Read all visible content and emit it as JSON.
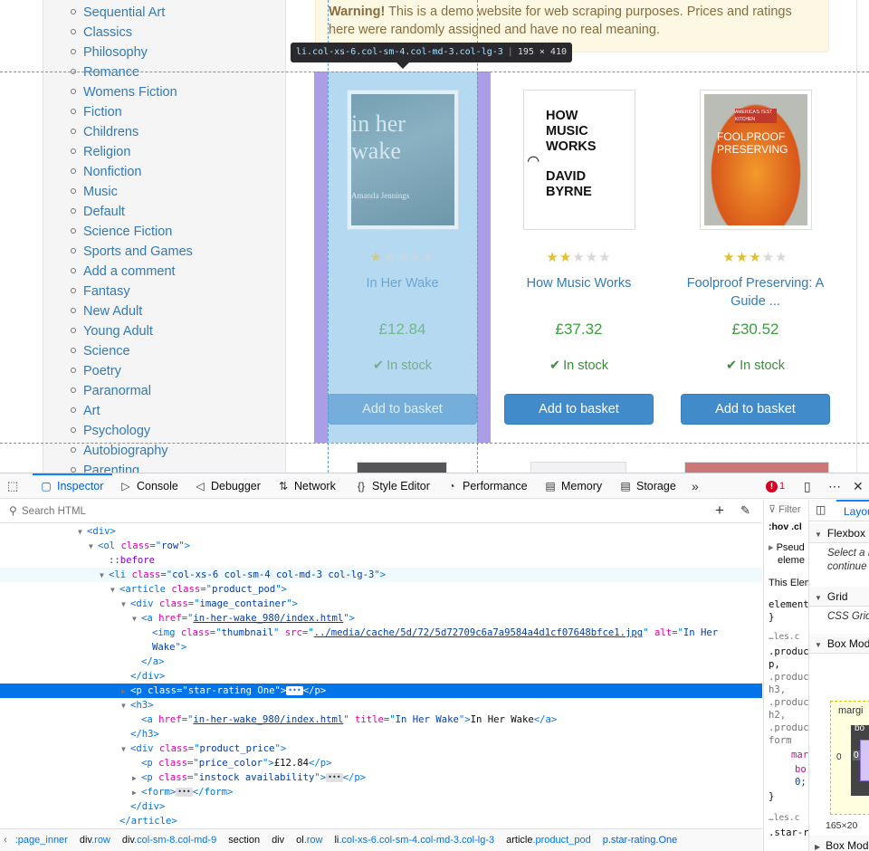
{
  "categories": [
    "Sequential Art",
    "Classics",
    "Philosophy",
    "Romance",
    "Womens Fiction",
    "Fiction",
    "Childrens",
    "Religion",
    "Nonfiction",
    "Music",
    "Default",
    "Science Fiction",
    "Sports and Games",
    "Add a comment",
    "Fantasy",
    "New Adult",
    "Young Adult",
    "Science",
    "Poetry",
    "Paranormal",
    "Art",
    "Psychology",
    "Autobiography",
    "Parenting"
  ],
  "warning": {
    "strong": "Warning!",
    "text": " This is a demo website for web scraping purposes. Prices and ratings here were randomly assigned and have no real meaning."
  },
  "tooltip": {
    "selector": "li.col-xs-6.col-sm-4.col-md-3.col-lg-3",
    "dims": "195 × 410"
  },
  "products": [
    {
      "title": "In Her Wake",
      "price": "£12.84",
      "rating": 1,
      "stock": "In stock",
      "button": "Add to basket",
      "cover_text": "in her wake",
      "cover_author": "Amanda Jennings"
    },
    {
      "title": "How Music Works",
      "price": "£37.32",
      "rating": 2,
      "stock": "In stock",
      "button": "Add to basket",
      "cover_text_1": "HOW MUSIC WORKS",
      "cover_text_2": "DAVID BYRNE"
    },
    {
      "title": "Foolproof Preserving: A Guide ...",
      "price": "£30.52",
      "rating": 3,
      "stock": "In stock",
      "button": "Add to basket",
      "cover_text_1": "FOOLPROOF PRESERVING",
      "cover_badge": "AMERICA'S TEST KITCHEN"
    }
  ],
  "devtools": {
    "tabs": [
      "Inspector",
      "Console",
      "Debugger",
      "Network",
      "Style Editor",
      "Performance",
      "Memory",
      "Storage"
    ],
    "active_tab": "Inspector",
    "error_count": "1",
    "search_placeholder": "Search HTML",
    "markup": [
      {
        "indent": 0,
        "twisty": "▼",
        "html": "<span class='tg'>&lt;div&gt;</span>"
      },
      {
        "indent": 1,
        "twisty": "▼",
        "html": "<span class='tg'>&lt;ol </span><span class='at'>class</span><span class='tg'>=\"</span><span class='av'>row</span><span class='tg'>\"&gt;</span>"
      },
      {
        "indent": 2,
        "twisty": "",
        "html": "<span class='pct'>::before</span>"
      },
      {
        "indent": 2,
        "twisty": "▼",
        "html": "<span class='tg'>&lt;li </span><span class='at'>class</span><span class='tg'>=\"</span><span class='av'>col-xs-6 col-sm-4 col-md-3 col-lg-3</span><span class='tg'>\"&gt;</span>",
        "hover": true
      },
      {
        "indent": 3,
        "twisty": "▼",
        "html": "<span class='tg'>&lt;article </span><span class='at'>class</span><span class='tg'>=\"</span><span class='av'>product_pod</span><span class='tg'>\"&gt;</span>"
      },
      {
        "indent": 4,
        "twisty": "▼",
        "html": "<span class='tg'>&lt;div </span><span class='at'>class</span><span class='tg'>=\"</span><span class='av'>image_container</span><span class='tg'>\"&gt;</span>"
      },
      {
        "indent": 5,
        "twisty": "▼",
        "html": "<span class='tg'>&lt;a </span><span class='at'>href</span><span class='tg'>=\"</span><span class='av lnk'>in-her-wake_980/index.html</span><span class='tg'>\"&gt;</span>"
      },
      {
        "indent": 6,
        "twisty": "",
        "html": "<span class='tg'>&lt;img </span><span class='at'>class</span><span class='tg'>=\"</span><span class='av'>thumbnail</span><span class='tg'>\" </span><span class='at'>src</span><span class='tg'>=\"</span><span class='av lnk'>../media/cache/5d/72/5d72709c6a7a9584a4d1cf07648bfce1.jpg</span><span class='tg'>\" </span><span class='at'>alt</span><span class='tg'>=\"</span><span class='av'>In Her</span>"
      },
      {
        "indent": 6,
        "twisty": "",
        "html": "<span class='av'>Wake</span><span class='tg'>\"&gt;</span>"
      },
      {
        "indent": 5,
        "twisty": "",
        "html": "<span class='tg'>&lt;/a&gt;</span>"
      },
      {
        "indent": 4,
        "twisty": "",
        "html": "<span class='tg'>&lt;/div&gt;</span>"
      },
      {
        "indent": 4,
        "twisty": "▶",
        "html": "<span class='tg'>&lt;p </span><span class='at'>class</span><span class='tg'>=\"</span><span class='av'>star-rating One</span><span class='tg'>\"&gt;</span><span class='ell'>•••</span><span class='tg'>&lt;/p&gt;</span>",
        "selected": true
      },
      {
        "indent": 4,
        "twisty": "▼",
        "html": "<span class='tg'>&lt;h3&gt;</span>"
      },
      {
        "indent": 5,
        "twisty": "",
        "html": "<span class='tg'>&lt;a </span><span class='at'>href</span><span class='tg'>=\"</span><span class='av lnk'>in-her-wake_980/index.html</span><span class='tg'>\" </span><span class='at'>title</span><span class='tg'>=\"</span><span class='av'>In Her Wake</span><span class='tg'>\"&gt;</span>In Her Wake<span class='tg'>&lt;/a&gt;</span>"
      },
      {
        "indent": 4,
        "twisty": "",
        "html": "<span class='tg'>&lt;/h3&gt;</span>"
      },
      {
        "indent": 4,
        "twisty": "▼",
        "html": "<span class='tg'>&lt;div </span><span class='at'>class</span><span class='tg'>=\"</span><span class='av'>product_price</span><span class='tg'>\"&gt;</span>"
      },
      {
        "indent": 5,
        "twisty": "",
        "html": "<span class='tg'>&lt;p </span><span class='at'>class</span><span class='tg'>=\"</span><span class='av'>price_color</span><span class='tg'>\"&gt;</span>£12.84<span class='tg'>&lt;/p&gt;</span>"
      },
      {
        "indent": 5,
        "twisty": "▶",
        "html": "<span class='tg'>&lt;p </span><span class='at'>class</span><span class='tg'>=\"</span><span class='av'>instock availability</span><span class='tg'>\"&gt;</span><span class='ell'>•••</span><span class='tg'>&lt;/p&gt;</span>"
      },
      {
        "indent": 5,
        "twisty": "▶",
        "html": "<span class='tg'>&lt;form&gt;</span><span class='ell'>•••</span><span class='tg'>&lt;/form&gt;</span>"
      },
      {
        "indent": 4,
        "twisty": "",
        "html": "<span class='tg'>&lt;/div&gt;</span>"
      },
      {
        "indent": 3,
        "twisty": "",
        "html": "<span class='tg'>&lt;/article&gt;</span>"
      }
    ],
    "breadcrumbs": [
      {
        "tag": "",
        "cls": ":page_inner"
      },
      {
        "tag": "div",
        "cls": ".row"
      },
      {
        "tag": "div",
        "cls": ".col-sm-8.col-md-9"
      },
      {
        "tag": "section",
        "cls": ""
      },
      {
        "tag": "div",
        "cls": ""
      },
      {
        "tag": "ol",
        "cls": ".row"
      },
      {
        "tag": "li",
        "cls": ".col-xs-6.col-sm-4.col-md-3.col-lg-3"
      },
      {
        "tag": "article",
        "cls": ".product_pod"
      },
      {
        "tag": "p",
        "cls": ".star-rating.One",
        "current": true
      }
    ],
    "rules": {
      "filter": "Filter",
      "hov": ":hov",
      "cls": ".cl",
      "pseudo_1": "Pseud",
      "pseudo_2": "eleme",
      "this_element": "This Elem",
      "element": "element",
      "brace_close": "}",
      "source_1": "…les.c",
      "sel_1": ".produc",
      "sel_2": "p,",
      "sel_3": ".produc",
      "sel_4": "h3,",
      "sel_5": ".produc",
      "sel_6": "h2,",
      "sel_7": ".produc",
      "sel_8": "form",
      "prop_1": "marg",
      "prop_2": "bo",
      "prop_3": "0;",
      "brace_close_2": "}",
      "source_2": "…les.c",
      "sel_9": ".star-r"
    },
    "layout": {
      "tab": "Layou",
      "flexbox": "Flexbox",
      "flex_note_1": "Select a F",
      "flex_note_2": "continue",
      "grid": "Grid",
      "grid_note": "CSS Grid",
      "box_model": "Box Mod",
      "margin_label": "margi",
      "border_label": "bo",
      "margin_left": "0",
      "border_left": "0",
      "size": "165×20",
      "box_model_2": "Box Mod"
    }
  }
}
